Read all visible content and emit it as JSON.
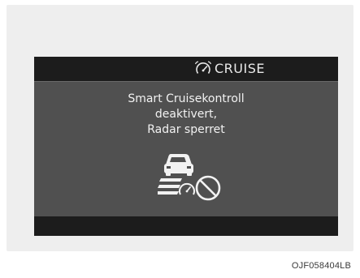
{
  "display": {
    "header": {
      "icon": "smart-cruise-speedometer-icon",
      "label": "CRUISE"
    },
    "message": {
      "line1": "Smart Cruisekontroll",
      "line2": "deaktivert,",
      "line3": "Radar sperret"
    },
    "warning_icon": "radar-blocked-car-icon"
  },
  "caption": "OJF058404LB",
  "colors": {
    "screen": "#505050",
    "bars": "#1c1c1c",
    "text": "#f2f2f2",
    "frame": "#eeeeee"
  }
}
